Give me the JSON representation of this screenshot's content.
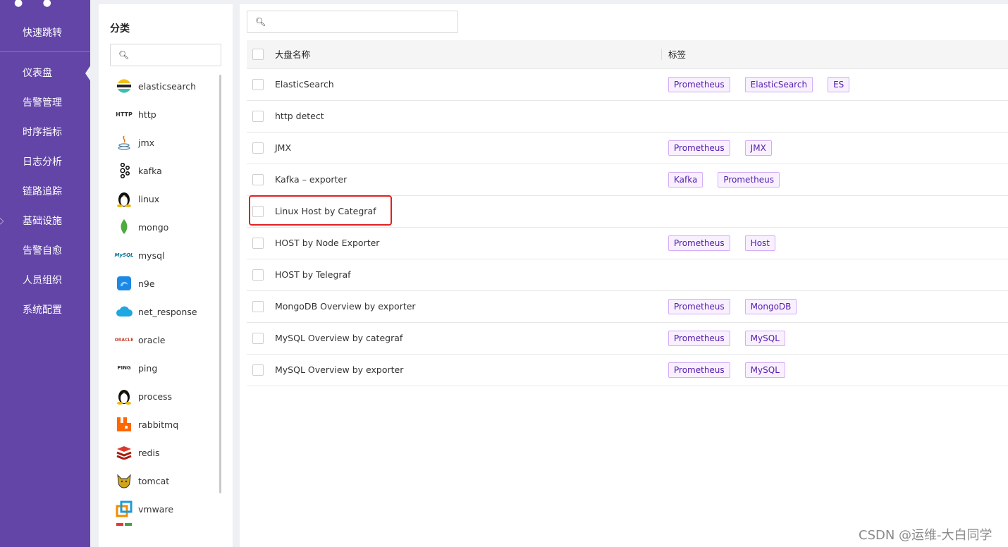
{
  "nav": {
    "quick_jump": "快速跳转",
    "items": [
      {
        "label": "仪表盘",
        "active": true
      },
      {
        "label": "告警管理"
      },
      {
        "label": "时序指标"
      },
      {
        "label": "日志分析"
      },
      {
        "label": "链路追踪"
      },
      {
        "label": "基础设施"
      },
      {
        "label": "告警自愈"
      },
      {
        "label": "人员组织"
      },
      {
        "label": "系统配置"
      }
    ]
  },
  "category": {
    "title": "分类",
    "search_placeholder": "",
    "items": [
      {
        "label": "elasticsearch",
        "icon": "elasticsearch-icon"
      },
      {
        "label": "http",
        "icon": "http-icon"
      },
      {
        "label": "jmx",
        "icon": "java-icon"
      },
      {
        "label": "kafka",
        "icon": "kafka-icon"
      },
      {
        "label": "linux",
        "icon": "linux-tux-icon"
      },
      {
        "label": "mongo",
        "icon": "mongo-leaf-icon"
      },
      {
        "label": "mysql",
        "icon": "mysql-icon"
      },
      {
        "label": "n9e",
        "icon": "n9e-icon"
      },
      {
        "label": "net_response",
        "icon": "cloud-icon"
      },
      {
        "label": "oracle",
        "icon": "oracle-icon"
      },
      {
        "label": "ping",
        "icon": "ping-icon"
      },
      {
        "label": "process",
        "icon": "linux-tux-icon"
      },
      {
        "label": "rabbitmq",
        "icon": "rabbitmq-icon"
      },
      {
        "label": "redis",
        "icon": "redis-icon"
      },
      {
        "label": "tomcat",
        "icon": "tomcat-icon"
      },
      {
        "label": "vmware",
        "icon": "vmware-icon"
      }
    ]
  },
  "table": {
    "search_placeholder": "",
    "col_name": "大盘名称",
    "col_tags": "标签",
    "rows": [
      {
        "name": "ElasticSearch",
        "tags": [
          "Prometheus",
          "ElasticSearch",
          "ES"
        ]
      },
      {
        "name": "http detect",
        "tags": []
      },
      {
        "name": "JMX",
        "tags": [
          "Prometheus",
          "JMX"
        ]
      },
      {
        "name": "Kafka – exporter",
        "tags": [
          "Kafka",
          "Prometheus"
        ]
      },
      {
        "name": "Linux Host by Categraf",
        "tags": []
      },
      {
        "name": "HOST by Node Exporter",
        "tags": [
          "Prometheus",
          "Host"
        ]
      },
      {
        "name": "HOST by Telegraf",
        "tags": []
      },
      {
        "name": "MongoDB Overview by exporter",
        "tags": [
          "Prometheus",
          "MongoDB"
        ]
      },
      {
        "name": "MySQL Overview by categraf",
        "tags": [
          "Prometheus",
          "MySQL"
        ]
      },
      {
        "name": "MySQL Overview by exporter",
        "tags": [
          "Prometheus",
          "MySQL"
        ]
      }
    ]
  },
  "colors": {
    "nav_bg": "#6345a8",
    "tag_bg": "#f9f0ff",
    "tag_border": "#d3adf7",
    "tag_text": "#531dab",
    "highlight": "#e02020"
  },
  "watermark": "CSDN @运维-大白同学"
}
